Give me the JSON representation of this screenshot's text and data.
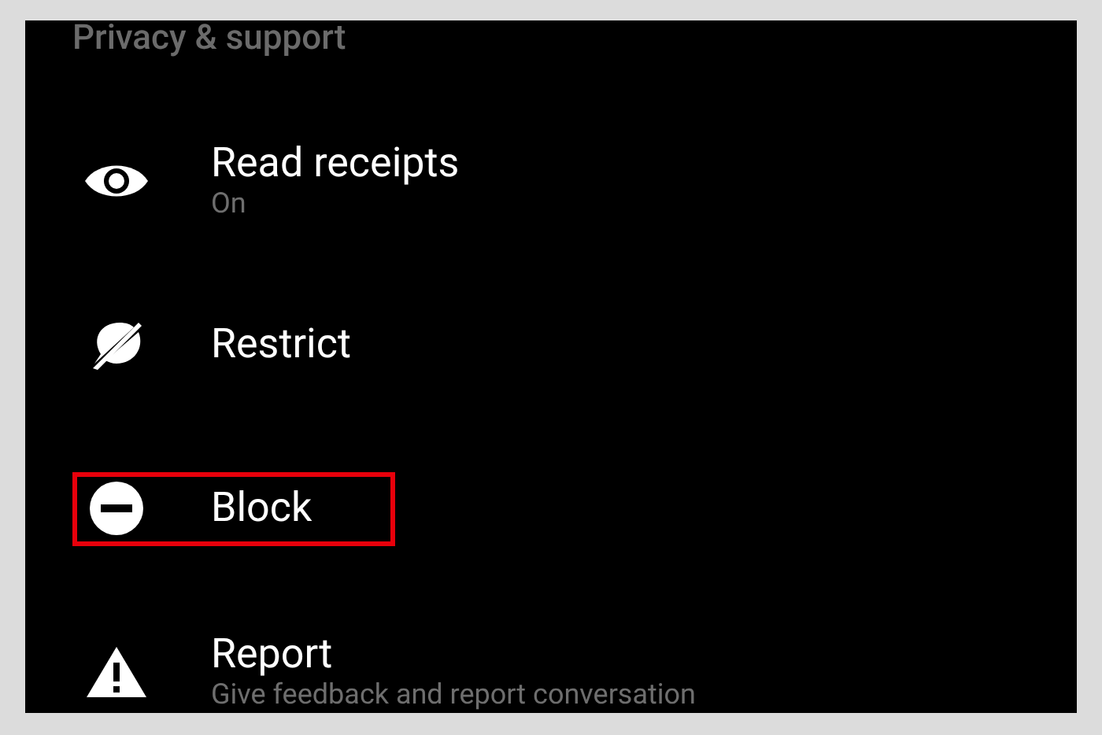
{
  "section_title": "Privacy & support",
  "items": [
    {
      "kind": "eye",
      "title": "Read receipts",
      "subtitle": "On",
      "highlighted": false
    },
    {
      "kind": "restrict",
      "title": "Restrict",
      "highlighted": false
    },
    {
      "kind": "block",
      "title": "Block",
      "highlighted": true
    },
    {
      "kind": "warning",
      "title": "Report",
      "subtitle": "Give feedback and report conversation",
      "highlighted": false
    }
  ]
}
